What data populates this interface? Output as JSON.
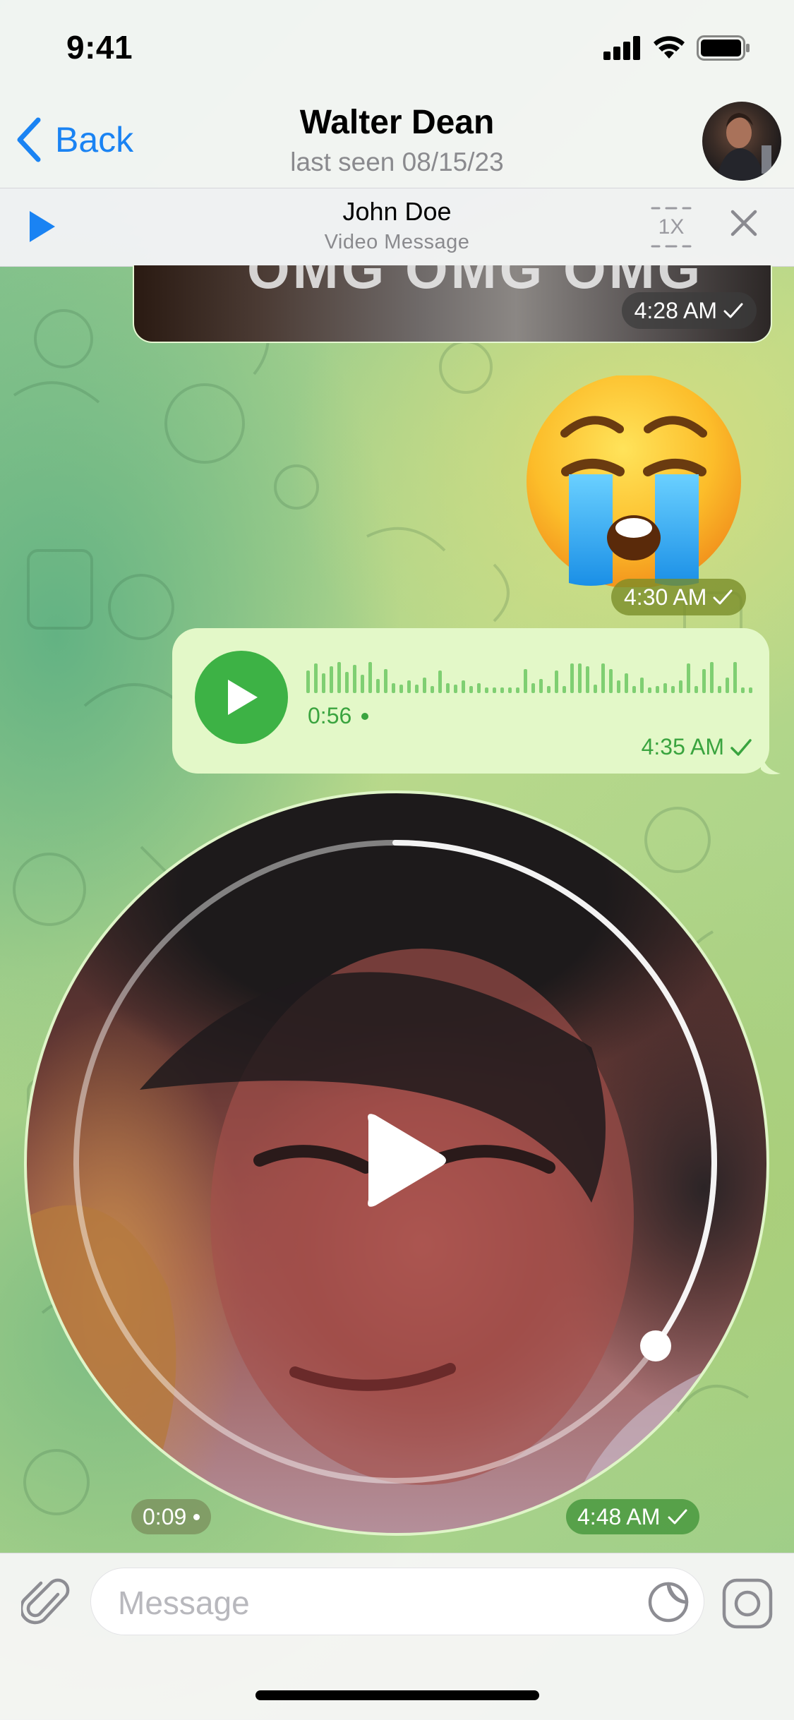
{
  "status_bar": {
    "time": "9:41"
  },
  "header": {
    "back_label": "Back",
    "title": "Walter Dean",
    "subtitle": "last seen 08/15/23"
  },
  "player": {
    "name": "John Doe",
    "kind": "Video Message",
    "speed": "1X"
  },
  "messages": {
    "gif": {
      "caption": "OMG OMG OMG",
      "time": "4:28 AM"
    },
    "emoji": {
      "symbol": "crying-face",
      "time": "4:30 AM"
    },
    "voice": {
      "duration": "0:56",
      "time": "4:35 AM"
    },
    "video_note": {
      "elapsed": "0:09",
      "time": "4:48 AM",
      "progress": 0.33
    }
  },
  "composer": {
    "placeholder": "Message"
  },
  "colors": {
    "accent_blue": "#1a83f3",
    "bubble_green": "#e3f8c8",
    "play_green": "#3db245"
  }
}
